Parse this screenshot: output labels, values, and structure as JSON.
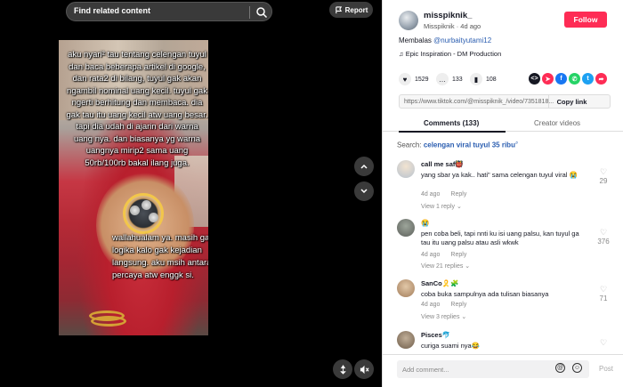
{
  "search": {
    "placeholder": "Find related content"
  },
  "report_label": "Report",
  "video": {
    "caption_top": "aku nyari² tau tentang celengan tuyul dan baca beberapa artikel di google, dan rata2 di bilang, tuyul gak akan ngambil nominal uang kecil. tuyul gak ngerti berhitung dan membaca. dia gak tau itu uang kecil atw uang besar. tapi dia udah di ajarin dari warna uang nya. dan biasanya yg warna uangnya mirip2 sama uang 50rb/100rb bakal ilang juga.",
    "caption_bottom": "wallahualam ya. masih gak logika kalo gak kejadian langsung. aku msih antara percaya atw enggk si."
  },
  "author": {
    "username": "misspiknik_",
    "display": "Misspiknik",
    "age": "4d ago",
    "follow_label": "Follow"
  },
  "description": {
    "prefix": "Membalas",
    "mention": "@nurbaityutami12"
  },
  "music": "Epic Inspiration - DM Production",
  "stats": {
    "likes": "1529",
    "comments": "133",
    "saves": "108"
  },
  "share_colors": {
    "embed": "#161823",
    "pinterest": "#fe2c55",
    "facebook": "#1877f2",
    "whatsapp": "#25d366",
    "twitter": "#1da1f2",
    "more": "#fe2c55"
  },
  "link": {
    "url": "https://www.tiktok.com/@misspiknik_/video/7351818...",
    "copy_label": "Copy link"
  },
  "tabs": [
    {
      "label": "Comments (133)"
    },
    {
      "label": "Creator videos"
    }
  ],
  "search_hint": {
    "prefix": "Search:",
    "query": "celengan viral tuyul 35 ribu"
  },
  "comments": [
    {
      "name": "call me saf👹",
      "text": "yang sbar ya kak.. hati\" sama celengan tuyul viral 😭",
      "date": "4d ago",
      "reply": "Reply",
      "replies": "View 1 reply ⌄",
      "likes": "29",
      "avatar_color": "#b8c3cf"
    },
    {
      "name": "😭",
      "text": "pen coba beli, tapi nnti ku isi uang palsu, kan tuyul ga tau itu uang palsu atau asli wkwk",
      "date": "4d ago",
      "reply": "Reply",
      "replies": "View 21 replies ⌄",
      "likes": "376",
      "avatar_color": "#6b6f6a"
    },
    {
      "name": "SanCo🎗️🧩",
      "text": "coba buka sampulnya ada tulisan biasanya",
      "date": "4d ago",
      "reply": "Reply",
      "replies": "View 3 replies ⌄",
      "likes": "71",
      "avatar_color": "#c9a27d"
    },
    {
      "name": "Pisces🐬",
      "text": "curiga suami nya😂",
      "date": "",
      "reply": "",
      "replies": "",
      "likes": "",
      "avatar_color": "#8a7a6a"
    }
  ],
  "add_comment": {
    "placeholder": "Add comment...",
    "post_label": "Post"
  }
}
